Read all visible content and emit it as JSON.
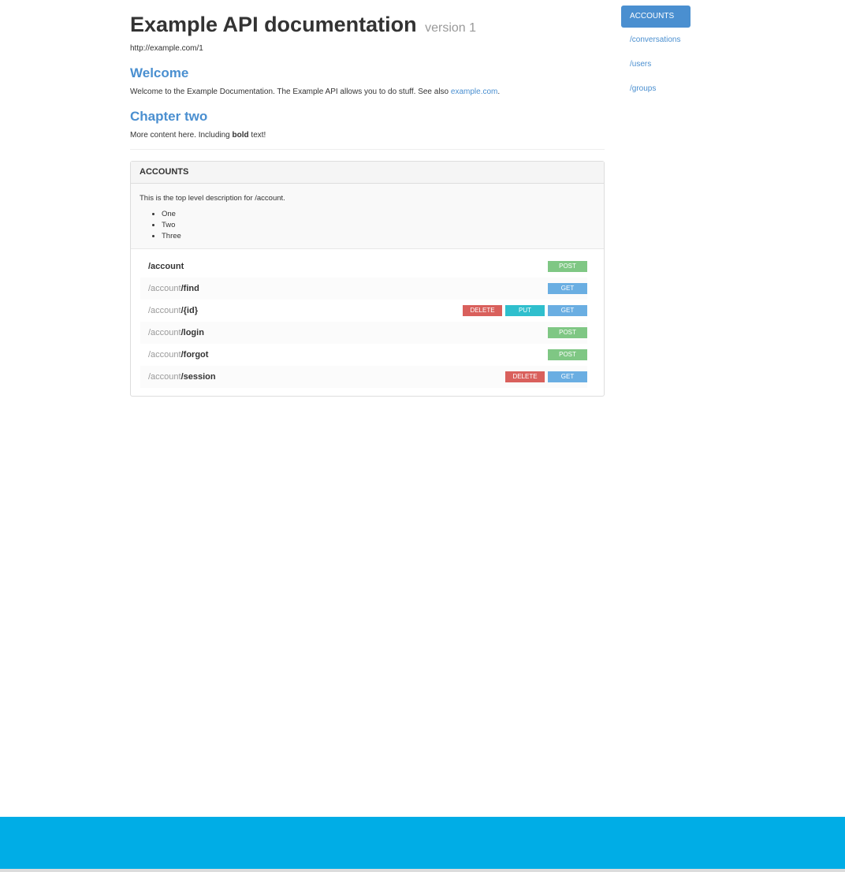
{
  "header": {
    "title": "Example API documentation",
    "version": "version 1",
    "base_url": "http://example.com/1"
  },
  "intro": {
    "welcome_heading": "Welcome",
    "welcome_text": "Welcome to the Example Documentation. The Example API allows you to do stuff. See also ",
    "welcome_link": "example.com",
    "welcome_end": ".",
    "chapter_heading": "Chapter two",
    "chapter_text_before": "More content here. Including ",
    "chapter_bold": "bold",
    "chapter_text_after": " text!"
  },
  "panel": {
    "heading": "ACCOUNTS",
    "description": "This is the top level description for /account.",
    "bullets": [
      "One",
      "Two",
      "Three"
    ],
    "routes": [
      {
        "prefix": "",
        "path": "/account",
        "methods": [
          "POST"
        ]
      },
      {
        "prefix": "/account",
        "path": "/find",
        "methods": [
          "GET"
        ]
      },
      {
        "prefix": "/account",
        "path": "/{id}",
        "methods": [
          "DELETE",
          "PUT",
          "GET"
        ]
      },
      {
        "prefix": "/account",
        "path": "/login",
        "methods": [
          "POST"
        ]
      },
      {
        "prefix": "/account",
        "path": "/forgot",
        "methods": [
          "POST"
        ]
      },
      {
        "prefix": "/account",
        "path": "/session",
        "methods": [
          "DELETE",
          "GET"
        ]
      }
    ]
  },
  "sidebar": {
    "items": [
      {
        "label": "ACCOUNTS",
        "active": true
      },
      {
        "label": "/conversations",
        "active": false
      },
      {
        "label": "/users",
        "active": false
      },
      {
        "label": "/groups",
        "active": false
      }
    ]
  },
  "colors": {
    "accent": "#4a8fd0",
    "post": "#7fc784",
    "get": "#6aaee2",
    "delete": "#d9605c",
    "put": "#2fbfcd",
    "footer": "#00ade6"
  }
}
